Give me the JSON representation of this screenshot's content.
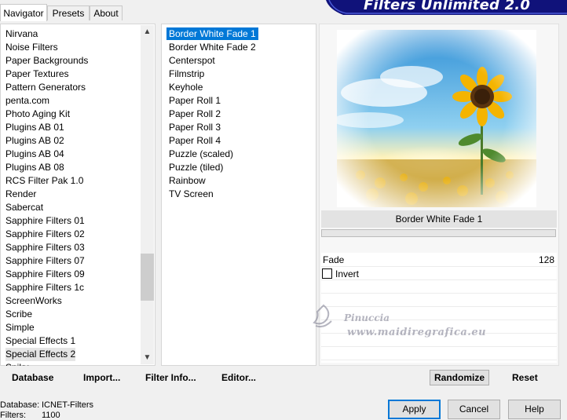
{
  "tabs": [
    {
      "label": "Navigator",
      "active": true
    },
    {
      "label": "Presets",
      "active": false
    },
    {
      "label": "About",
      "active": false
    }
  ],
  "banner": {
    "title": "Filters Unlimited 2.0"
  },
  "categories": [
    "Nirvana",
    "Noise Filters",
    "Paper Backgrounds",
    "Paper Textures",
    "Pattern Generators",
    "penta.com",
    "Photo Aging Kit",
    "Plugins AB 01",
    "Plugins AB 02",
    "Plugins AB 04",
    "Plugins AB 08",
    "RCS Filter Pak 1.0",
    "Render",
    "Sabercat",
    "Sapphire Filters 01",
    "Sapphire Filters 02",
    "Sapphire Filters 03",
    "Sapphire Filters 07",
    "Sapphire Filters 09",
    "Sapphire Filters 1c",
    "ScreenWorks",
    "Scribe",
    "Simple",
    "Special Effects 1",
    "Special Effects 2",
    "Spiky"
  ],
  "selected_category": "Special Effects 2",
  "filters": [
    "Border White Fade 1",
    "Border White Fade 2",
    "Centerspot",
    "Filmstrip",
    "Keyhole",
    "Paper Roll 1",
    "Paper Roll 2",
    "Paper Roll 3",
    "Paper Roll 4",
    "Puzzle (scaled)",
    "Puzzle (tiled)",
    "Rainbow",
    "TV Screen"
  ],
  "selected_filter": "Border White Fade 1",
  "preview": {
    "filter_name": "Border White Fade 1"
  },
  "parameters": {
    "fade_label": "Fade",
    "fade_value": "128",
    "invert_label": "Invert",
    "invert_checked": false
  },
  "toolbar": {
    "database": "Database",
    "import": "Import...",
    "filter_info": "Filter Info...",
    "editor": "Editor...",
    "randomize": "Randomize",
    "reset": "Reset"
  },
  "status": {
    "database_label": "Database:",
    "database_value": "ICNET-Filters",
    "filters_label": "Filters:",
    "filters_value": "1100"
  },
  "buttons": {
    "apply": "Apply",
    "cancel": "Cancel",
    "help": "Help"
  },
  "watermark": {
    "line1": "Pinuccia",
    "line2": "www.maidiregrafica.eu"
  },
  "colors": {
    "selection": "#0078d7",
    "banner": "#10127a"
  }
}
